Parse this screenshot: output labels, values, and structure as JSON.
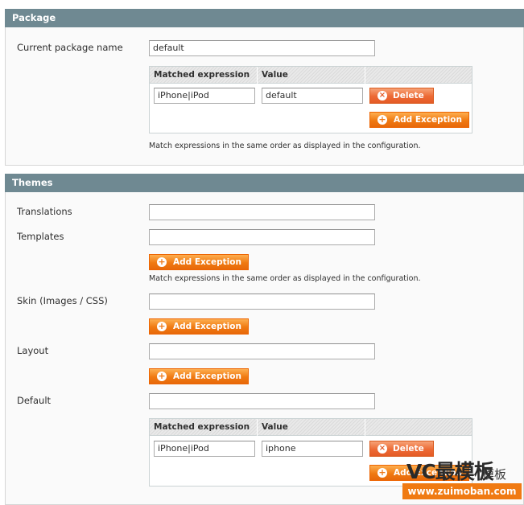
{
  "package": {
    "title": "Package",
    "current_package_label": "Current package name",
    "current_package_value": "default",
    "grid": {
      "col_expression": "Matched expression",
      "col_value": "Value",
      "rows": [
        {
          "expression": "iPhone|iPod",
          "value": "default"
        }
      ],
      "delete_label": "Delete",
      "add_exception_label": "Add Exception"
    },
    "note": "Match expressions in the same order as displayed in the configuration."
  },
  "themes": {
    "title": "Themes",
    "translations_label": "Translations",
    "translations_value": "",
    "templates_label": "Templates",
    "templates_value": "",
    "templates_add_exception": "Add Exception",
    "templates_note": "Match expressions in the same order as displayed in the configuration.",
    "skin_label": "Skin (Images / CSS)",
    "skin_value": "",
    "skin_add_exception": "Add Exception",
    "layout_label": "Layout",
    "layout_value": "",
    "layout_add_exception": "Add Exception",
    "default_label": "Default",
    "default_value": "",
    "grid": {
      "col_expression": "Matched expression",
      "col_value": "Value",
      "rows": [
        {
          "expression": "iPhone|iPod",
          "value": "iphone"
        }
      ],
      "delete_label": "Delete",
      "add_exception_label": "Add Exception"
    }
  },
  "watermark": {
    "line1": "VC最模板",
    "line2": "模板",
    "line3": "www.zuimoban.com"
  },
  "colors": {
    "section_header": "#6f8992",
    "button_orange": "#f07a12"
  },
  "icons": {
    "add": "plus-circle-icon",
    "delete": "x-circle-icon"
  }
}
